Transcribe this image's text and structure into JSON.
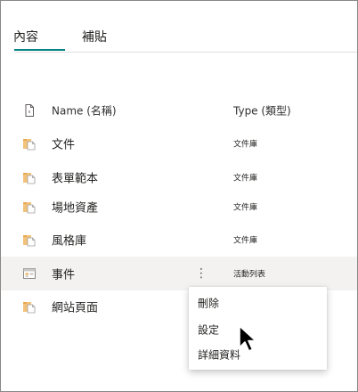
{
  "tabs": [
    {
      "label": "內容",
      "selected": true
    },
    {
      "label": "補貼",
      "selected": false
    }
  ],
  "accent_color": "#038387",
  "columns": {
    "name": "Name (名稱)",
    "type": "Type (類型)"
  },
  "rows": [
    {
      "name": "文件",
      "type": "文件庫",
      "icon": "library-icon"
    },
    {
      "name": "表單範本",
      "type": "文件庫",
      "icon": "library-icon"
    },
    {
      "name": "場地資產",
      "type": "文件庫",
      "icon": "library-icon"
    },
    {
      "name": "風格庫",
      "type": "文件庫",
      "icon": "library-icon"
    },
    {
      "name": "事件",
      "type": "活動列表",
      "icon": "calendar-list-icon",
      "highlighted": true,
      "more": "⋮"
    },
    {
      "name": "網站頁面",
      "type": "",
      "icon": "library-icon"
    }
  ],
  "context_menu": {
    "items": [
      "刪除",
      "設定",
      "詳細資料"
    ]
  }
}
